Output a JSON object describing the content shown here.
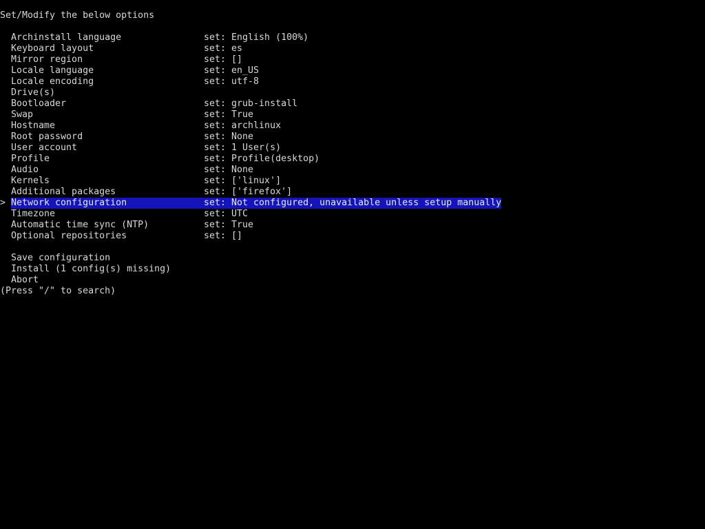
{
  "header": "Set/Modify the below options",
  "cursor_glyph": ">",
  "options": [
    {
      "label": "Archinstall language",
      "value": "set: English (100%)",
      "selected": false
    },
    {
      "label": "Keyboard layout",
      "value": "set: es",
      "selected": false
    },
    {
      "label": "Mirror region",
      "value": "set: []",
      "selected": false
    },
    {
      "label": "Locale language",
      "value": "set: en_US",
      "selected": false
    },
    {
      "label": "Locale encoding",
      "value": "set: utf-8",
      "selected": false
    },
    {
      "label": "Drive(s)",
      "value": "",
      "selected": false
    },
    {
      "label": "Bootloader",
      "value": "set: grub-install",
      "selected": false
    },
    {
      "label": "Swap",
      "value": "set: True",
      "selected": false
    },
    {
      "label": "Hostname",
      "value": "set: archlinux",
      "selected": false
    },
    {
      "label": "Root password",
      "value": "set: None",
      "selected": false
    },
    {
      "label": "User account",
      "value": "set: 1 User(s)",
      "selected": false
    },
    {
      "label": "Profile",
      "value": "set: Profile(desktop)",
      "selected": false
    },
    {
      "label": "Audio",
      "value": "set: None",
      "selected": false
    },
    {
      "label": "Kernels",
      "value": "set: ['linux']",
      "selected": false
    },
    {
      "label": "Additional packages",
      "value": "set: ['firefox']",
      "selected": false
    },
    {
      "label": "Network configuration",
      "value": "set: Not configured, unavailable unless setup manually",
      "selected": true
    },
    {
      "label": "Timezone",
      "value": "set: UTC",
      "selected": false
    },
    {
      "label": "Automatic time sync (NTP)",
      "value": "set: True",
      "selected": false
    },
    {
      "label": "Optional repositories",
      "value": "set: []",
      "selected": false
    }
  ],
  "actions": [
    {
      "label": "Save configuration"
    },
    {
      "label": "Install (1 config(s) missing)"
    },
    {
      "label": "Abort"
    }
  ],
  "search_hint": "(Press \"/\" to search)",
  "colors": {
    "background": "#000000",
    "text": "#d8d8d8",
    "selection": "#1414b8"
  }
}
